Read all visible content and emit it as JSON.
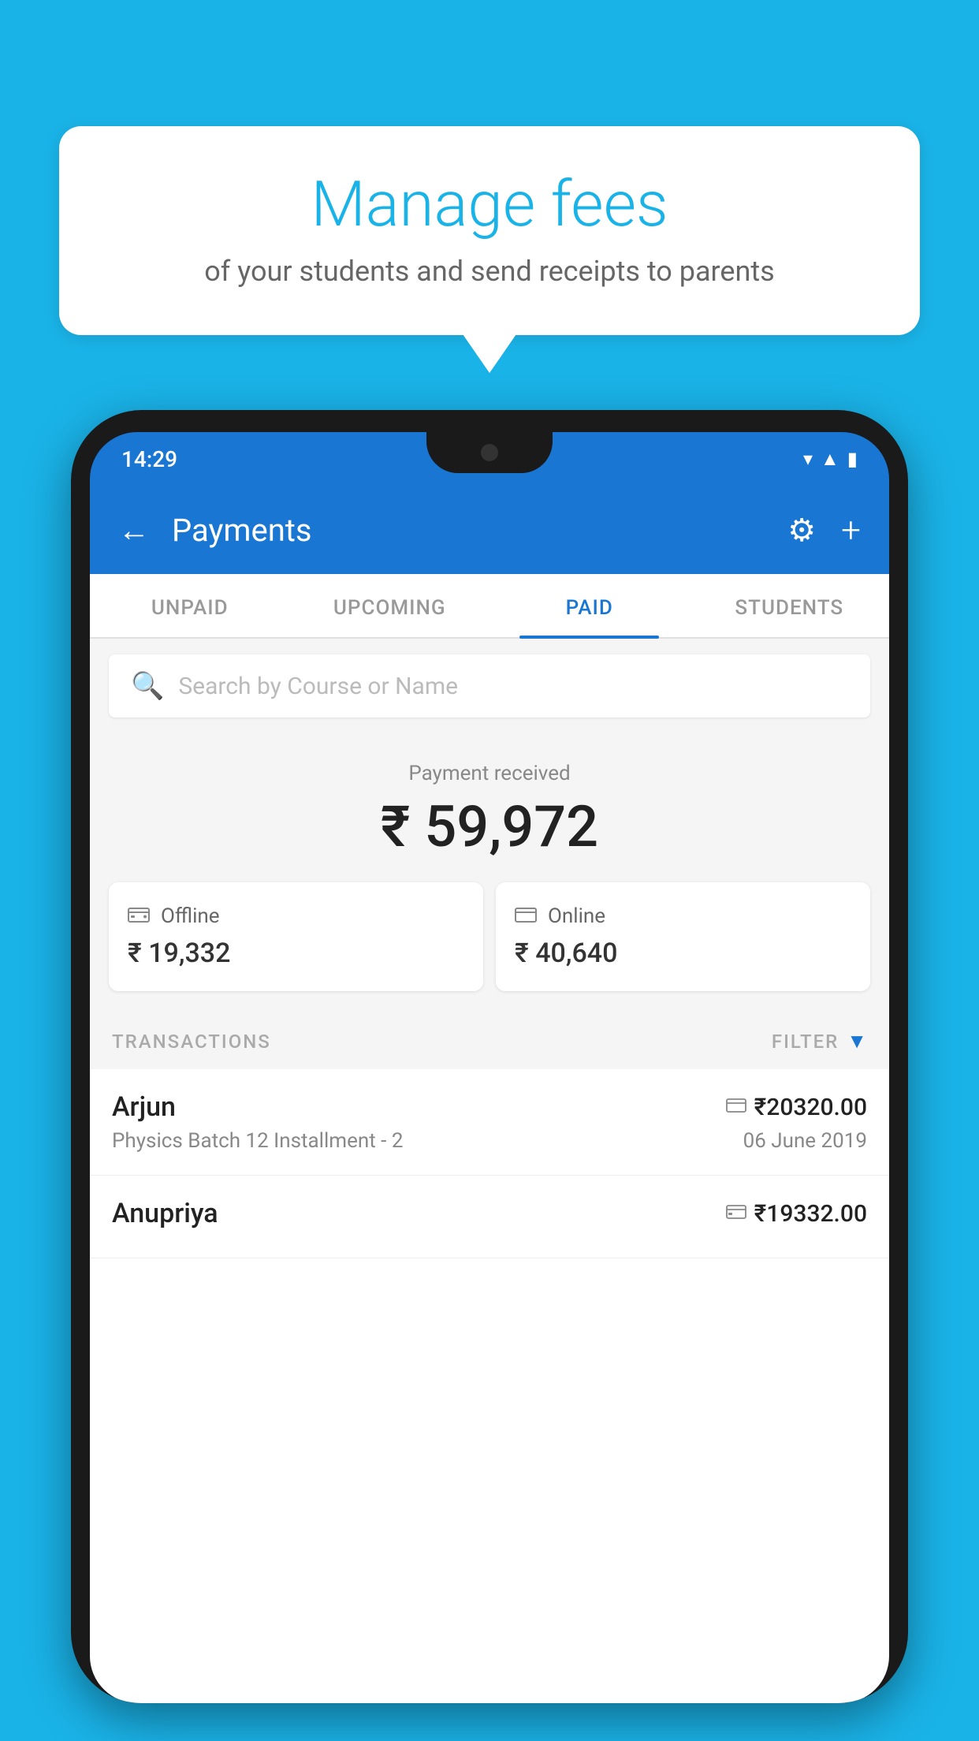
{
  "background_color": "#1ab3e8",
  "speech_bubble": {
    "title": "Manage fees",
    "subtitle": "of your students and send receipts to parents"
  },
  "phone": {
    "status_bar": {
      "time": "14:29"
    },
    "app_bar": {
      "title": "Payments",
      "back_label": "←",
      "plus_label": "+"
    },
    "tabs": [
      {
        "label": "UNPAID",
        "active": false
      },
      {
        "label": "UPCOMING",
        "active": false
      },
      {
        "label": "PAID",
        "active": true
      },
      {
        "label": "STUDENTS",
        "active": false
      }
    ],
    "search": {
      "placeholder": "Search by Course or Name"
    },
    "payment_received": {
      "label": "Payment received",
      "amount": "₹ 59,972"
    },
    "payment_cards": [
      {
        "label": "Offline",
        "amount": "₹ 19,332",
        "icon": "offline-icon"
      },
      {
        "label": "Online",
        "amount": "₹ 40,640",
        "icon": "online-icon"
      }
    ],
    "transactions_section": {
      "label": "TRANSACTIONS",
      "filter_label": "FILTER"
    },
    "transactions": [
      {
        "name": "Arjun",
        "amount": "₹20320.00",
        "course": "Physics Batch 12 Installment - 2",
        "date": "06 June 2019",
        "type": "online"
      },
      {
        "name": "Anupriya",
        "amount": "₹19332.00",
        "course": "",
        "date": "",
        "type": "offline"
      }
    ]
  }
}
